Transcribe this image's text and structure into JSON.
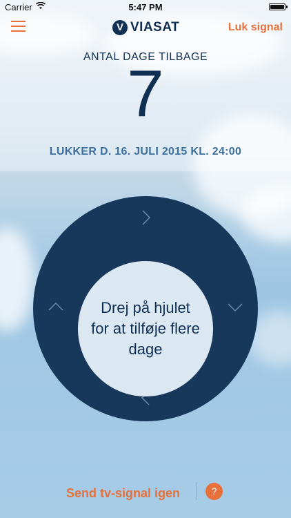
{
  "status_bar": {
    "carrier": "Carrier",
    "wifi_icon": "wifi-icon",
    "time": "5:47 PM",
    "battery_icon": "battery-icon"
  },
  "nav": {
    "menu_icon": "hamburger-icon",
    "logo_text": "VIASAT",
    "close_signal_label": "Luk signal"
  },
  "days": {
    "label": "ANTAL DAGE TILBAGE",
    "value": "7"
  },
  "closes_text": "LUKKER D. 16. JULI 2015 KL. 24:00",
  "wheel": {
    "instruction": "Drej på hjulet for at tilføje flere dage",
    "icons": [
      "chevron-right-icon",
      "chevron-down-icon",
      "chevron-left-icon",
      "chevron-up-icon"
    ]
  },
  "bottom": {
    "send_again_label": "Send tv-signal igen",
    "help_label": "?"
  },
  "colors": {
    "accent": "#e8703a",
    "navy": "#17385a",
    "text_dark": "#0f2f53",
    "text_blue": "#3c6f9e"
  }
}
